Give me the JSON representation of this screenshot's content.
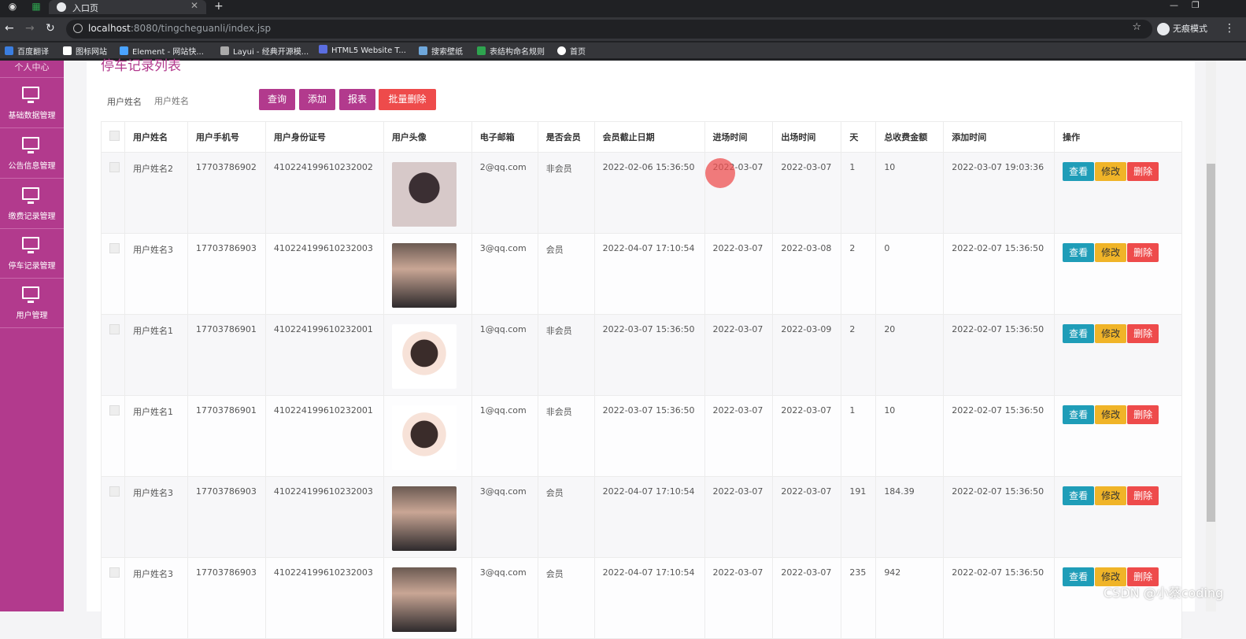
{
  "browser": {
    "tab_title": "入口页",
    "url_host": "localhost",
    "url_path": ":8080/tingcheguanli/index.jsp",
    "incognito_label": "无痕模式",
    "bookmarks": [
      "百度翻译",
      "图标网站",
      "Element - 网站快...",
      "Layui - 经典开源模...",
      "HTML5 Website T...",
      "搜索壁纸",
      "表结构命名规则",
      "首页"
    ]
  },
  "sidebar": {
    "top_label": "个人中心",
    "items": [
      {
        "label": "基础数据管理",
        "icon": "monitor-icon"
      },
      {
        "label": "公告信息管理",
        "icon": "monitor-icon"
      },
      {
        "label": "缴费记录管理",
        "icon": "monitor-icon"
      },
      {
        "label": "停车记录管理",
        "icon": "monitor-icon"
      },
      {
        "label": "用户管理",
        "icon": "monitor-icon"
      }
    ]
  },
  "page": {
    "title": "停车记录列表",
    "search_label": "用户姓名",
    "search_placeholder": "用户姓名",
    "buttons": {
      "query": "查询",
      "add": "添加",
      "report": "报表",
      "batch_delete": "批量删除"
    }
  },
  "table": {
    "headers": [
      "用户姓名",
      "用户手机号",
      "用户身份证号",
      "用户头像",
      "电子邮箱",
      "是否会员",
      "会员截止日期",
      "进场时间",
      "出场时间",
      "天",
      "总收费金额",
      "添加时间",
      "操作"
    ],
    "actions": {
      "view": "查看",
      "edit": "修改",
      "delete": "删除"
    },
    "rows": [
      {
        "name": "用户姓名2",
        "phone": "17703786902",
        "id_card": "410224199610232002",
        "avatar": "pillow",
        "email": "2@qq.com",
        "member": "非会员",
        "member_expire": "2022-02-06 15:36:50",
        "enter_time": "2022-03-07",
        "exit_time": "2022-03-07",
        "days": "1",
        "total_fee": "10",
        "add_time": "2022-03-07 19:03:36"
      },
      {
        "name": "用户姓名3",
        "phone": "17703786903",
        "id_card": "410224199610232003",
        "avatar": "photo",
        "email": "3@qq.com",
        "member": "会员",
        "member_expire": "2022-04-07 17:10:54",
        "enter_time": "2022-03-07",
        "exit_time": "2022-03-08",
        "days": "2",
        "total_fee": "0",
        "add_time": "2022-02-07 15:36:50"
      },
      {
        "name": "用户姓名1",
        "phone": "17703786901",
        "id_card": "410224199610232001",
        "avatar": "cartoon",
        "email": "1@qq.com",
        "member": "非会员",
        "member_expire": "2022-03-07 15:36:50",
        "enter_time": "2022-03-07",
        "exit_time": "2022-03-09",
        "days": "2",
        "total_fee": "20",
        "add_time": "2022-02-07 15:36:50"
      },
      {
        "name": "用户姓名1",
        "phone": "17703786901",
        "id_card": "410224199610232001",
        "avatar": "cartoon",
        "email": "1@qq.com",
        "member": "非会员",
        "member_expire": "2022-03-07 15:36:50",
        "enter_time": "2022-03-07",
        "exit_time": "2022-03-07",
        "days": "1",
        "total_fee": "10",
        "add_time": "2022-02-07 15:36:50"
      },
      {
        "name": "用户姓名3",
        "phone": "17703786903",
        "id_card": "410224199610232003",
        "avatar": "photo",
        "email": "3@qq.com",
        "member": "会员",
        "member_expire": "2022-04-07 17:10:54",
        "enter_time": "2022-03-07",
        "exit_time": "2022-03-07",
        "days": "191",
        "total_fee": "184.39",
        "add_time": "2022-02-07 15:36:50"
      },
      {
        "name": "用户姓名3",
        "phone": "17703786903",
        "id_card": "410224199610232003",
        "avatar": "photo",
        "email": "3@qq.com",
        "member": "会员",
        "member_expire": "2022-04-07 17:10:54",
        "enter_time": "2022-03-07",
        "exit_time": "2022-03-07",
        "days": "235",
        "total_fee": "942",
        "add_time": "2022-02-07 15:36:50"
      }
    ]
  },
  "watermark": "CSDN @小蔡coding",
  "colors": {
    "primary": "#b23a8d",
    "danger": "#ee4b4b",
    "info": "#1f9db8",
    "warning": "#f0b428"
  }
}
